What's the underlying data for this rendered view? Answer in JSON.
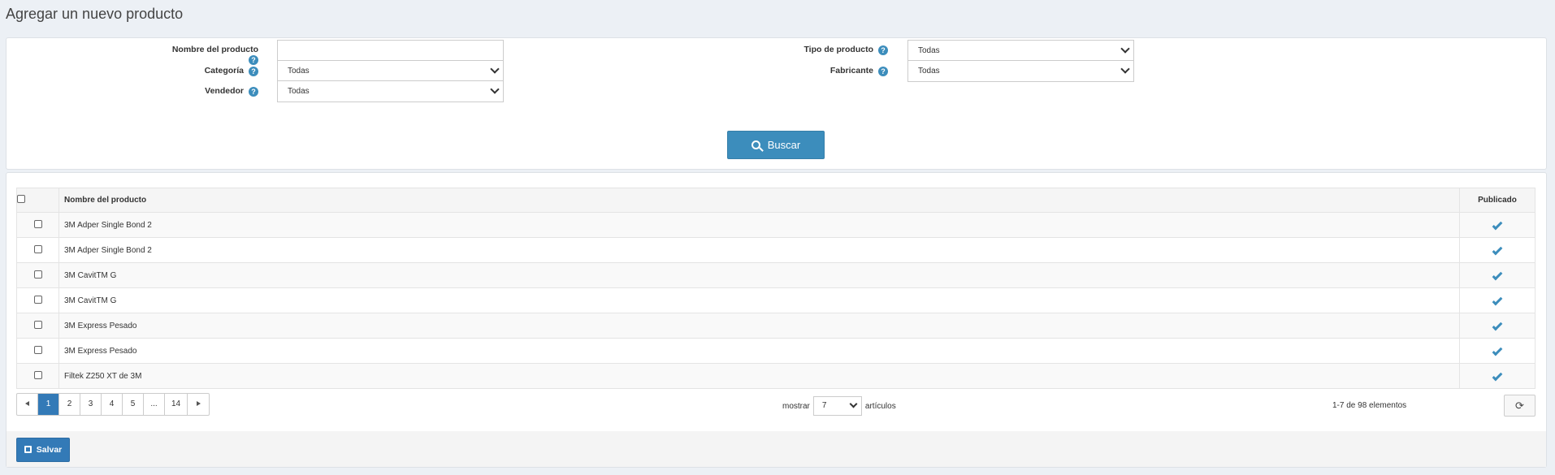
{
  "page": {
    "title": "Agregar un nuevo producto"
  },
  "search": {
    "product_name_label": "Nombre del producto",
    "product_name_value": "",
    "category_label": "Categoría",
    "category_value": "Todas",
    "vendor_label": "Vendedor",
    "vendor_value": "Todas",
    "product_type_label": "Tipo de producto",
    "product_type_value": "Todas",
    "manufacturer_label": "Fabricante",
    "manufacturer_value": "Todas",
    "help_glyph": "?",
    "search_button": "Buscar"
  },
  "grid": {
    "columns": {
      "name": "Nombre del producto",
      "published": "Publicado"
    },
    "rows": [
      {
        "name": "3M Adper Single Bond 2",
        "published": true
      },
      {
        "name": "3M Adper Single Bond 2",
        "published": true
      },
      {
        "name": "3M CavitTM G",
        "published": true
      },
      {
        "name": "3M CavitTM G",
        "published": true
      },
      {
        "name": "3M Express Pesado",
        "published": true
      },
      {
        "name": "3M Express Pesado",
        "published": true
      },
      {
        "name": "Filtek Z250 XT de 3M",
        "published": true
      }
    ],
    "pager": {
      "pages": [
        "1",
        "2",
        "3",
        "4",
        "5",
        "...",
        "14"
      ],
      "current": "1"
    },
    "page_size": {
      "prefix": "mostrar",
      "value": "7",
      "suffix": "artículos"
    },
    "items_info": "1-7 de 98 elementos",
    "refresh_glyph": "⟳"
  },
  "footer": {
    "save_button": "Salvar"
  },
  "colors": {
    "accent": "#3c8dbc",
    "primary": "#337ab7",
    "background": "#ecf0f5"
  }
}
